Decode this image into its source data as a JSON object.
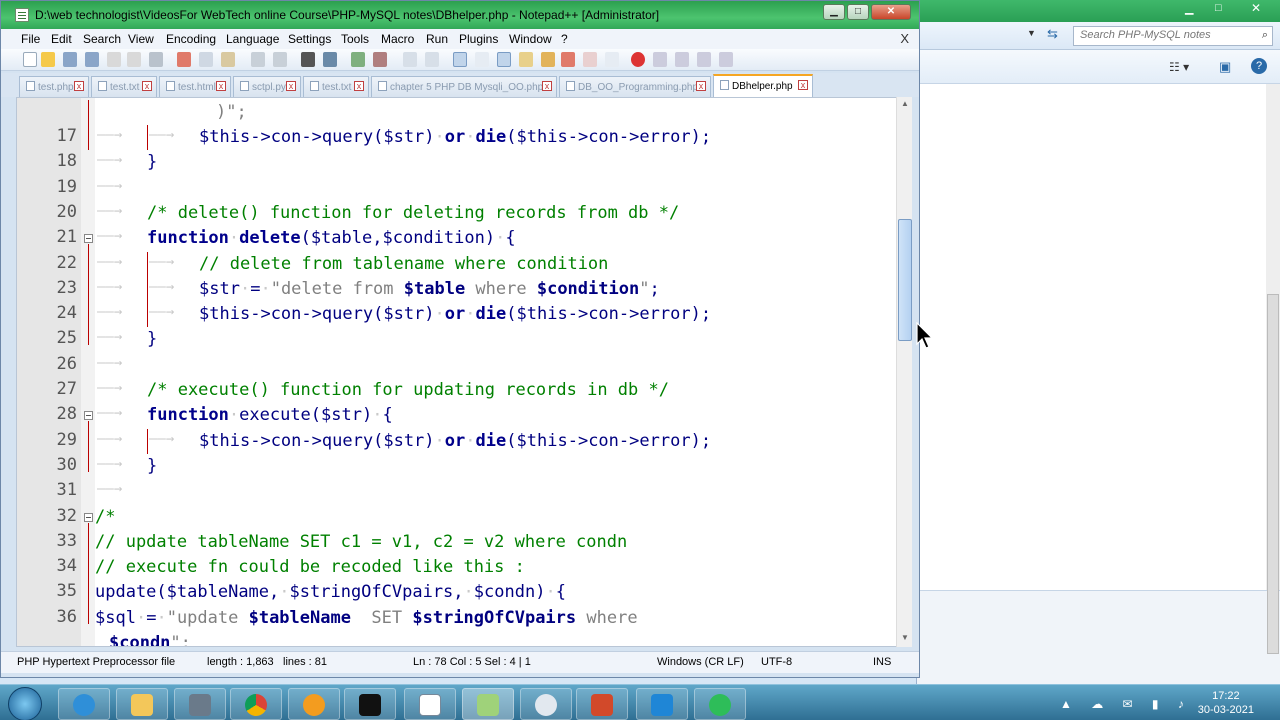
{
  "window": {
    "title": "D:\\web technologist\\VideosFor WebTech online Course\\PHP-MySQL notes\\DBhelper.php - Notepad++ [Administrator]"
  },
  "menu": {
    "items": [
      "File",
      "Edit",
      "Search",
      "View",
      "Encoding",
      "Language",
      "Settings",
      "Tools",
      "Macro",
      "Run",
      "Plugins",
      "Window",
      "?"
    ],
    "close_label": "X"
  },
  "tabs": [
    {
      "label": "test.php",
      "active": false
    },
    {
      "label": "test.txt",
      "active": false
    },
    {
      "label": "test.html",
      "active": false
    },
    {
      "label": "sctpl.py",
      "active": false
    },
    {
      "label": "test.txt",
      "active": false
    },
    {
      "label": "chapter 5 PHP DB Mysqli_OO.php",
      "active": false
    },
    {
      "label": "DB_OO_Programming.php",
      "active": false
    },
    {
      "label": "DBhelper.php",
      "active": true
    }
  ],
  "editor": {
    "top_partial_line": ")\";",
    "lines": [
      {
        "num": "17",
        "text": "$this->con->query($str) or die($this->con->error);"
      },
      {
        "num": "18",
        "text": "}"
      },
      {
        "num": "19",
        "text": ""
      },
      {
        "num": "20",
        "text": "/* delete() function for deleting records from db */"
      },
      {
        "num": "21",
        "text": "function delete($table,$condition) {"
      },
      {
        "num": "22",
        "text": "// delete from tablename where condition"
      },
      {
        "num": "23",
        "text": "$str = \"delete from $table where $condition\";"
      },
      {
        "num": "24",
        "text": "$this->con->query($str) or die($this->con->error);"
      },
      {
        "num": "25",
        "text": "}"
      },
      {
        "num": "26",
        "text": ""
      },
      {
        "num": "27",
        "text": "/* execute() function for updating records in db */"
      },
      {
        "num": "28",
        "text": "function execute($str) {"
      },
      {
        "num": "29",
        "text": "$this->con->query($str) or die($this->con->error);"
      },
      {
        "num": "30",
        "text": "}"
      },
      {
        "num": "31",
        "text": ""
      },
      {
        "num": "32",
        "text": "/*"
      },
      {
        "num": "33",
        "text": "// update tableName SET c1 = v1, c2 = v2 where condn"
      },
      {
        "num": "34",
        "text": "// execute fn could be recoded like this :"
      },
      {
        "num": "35",
        "text": "update($tableName, $stringOfCVpairs, $condn) {"
      },
      {
        "num": "36",
        "text": "$sql = \"update $tableName  SET $stringOfCVpairs where"
      }
    ],
    "bottom_partial_line": "$condn\";"
  },
  "status": {
    "filetype": "PHP Hypertext Preprocessor file",
    "length": "length : 1,863",
    "lines": "lines : 81",
    "position": "Ln : 78   Col : 5   Sel : 4 | 1",
    "eol": "Windows (CR LF)",
    "encoding": "UTF-8",
    "mode": "INS"
  },
  "background_window": {
    "search_placeholder": "Search PHP-MySQL notes"
  },
  "taskbar": {
    "time": "17:22",
    "date": "30-03-2021"
  },
  "colors": {
    "keyword": "#00008b",
    "comment": "#008000",
    "string": "#808080",
    "titlebar": "#3fb86b"
  }
}
